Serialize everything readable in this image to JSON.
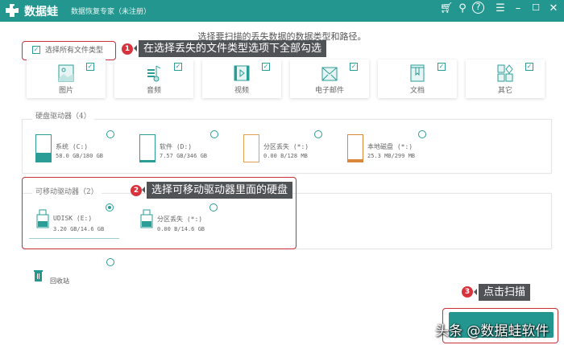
{
  "titlebar": {
    "app_name": "数据蛙",
    "subtitle": "数据恢复专家（未注册）",
    "icons": [
      "cart-icon",
      "pin-icon",
      "help-icon",
      "menu-icon",
      "minimize-icon",
      "maximize-icon",
      "close-icon"
    ]
  },
  "heading": "选择要扫描的丢失数据的数据类型和路径。",
  "select_all": {
    "label": "选择所有文件类型",
    "checked": true
  },
  "callouts": [
    {
      "num": "1",
      "text": "在选择丢失的文件类型选项下全部勾选"
    },
    {
      "num": "2",
      "text": "选择可移动驱动器里面的硬盘"
    },
    {
      "num": "3",
      "text": "点击扫描"
    }
  ],
  "file_types": [
    {
      "label": "图片",
      "icon": "image-icon",
      "checked": true
    },
    {
      "label": "音频",
      "icon": "audio-icon",
      "checked": true
    },
    {
      "label": "视频",
      "icon": "video-icon",
      "checked": true
    },
    {
      "label": "电子邮件",
      "icon": "email-icon",
      "checked": true
    },
    {
      "label": "文档",
      "icon": "document-icon",
      "checked": true
    },
    {
      "label": "其它",
      "icon": "other-icon",
      "checked": true
    }
  ],
  "hard_drives": {
    "title": "硬盘驱动器（4）",
    "items": [
      {
        "name": "系统 (C:)",
        "size": "58.0 GB/180 GB",
        "fill": 0.32,
        "color": "#2a9d96",
        "selected": false
      },
      {
        "name": "软件 (D:)",
        "size": "7.57 GB/346 GB",
        "fill": 0.02,
        "color": "#2a9d96",
        "selected": false
      },
      {
        "name": "分区丢失 (*:)",
        "size": "0.00  B/128 MB",
        "fill": 0,
        "color": "#e0a050",
        "selected": false
      },
      {
        "name": "本地磁盘 (*:)",
        "size": "25.3 MB/299 MB",
        "fill": 0.08,
        "color": "#d8883a",
        "selected": false
      }
    ]
  },
  "removable_drives": {
    "title": "可移动驱动器（2）",
    "items": [
      {
        "name": "UDISK (E:)",
        "size": "3.20 GB/14.6 GB",
        "selected": true
      },
      {
        "name": "分区丢失 (*:)",
        "size": "0.00  B/14.6 GB",
        "selected": false
      }
    ]
  },
  "recycle_bin": {
    "label": "回收站",
    "selected": false
  },
  "scan_button": {
    "label": ""
  },
  "watermark": "头条 @数据蛙软件",
  "colors": {
    "accent": "#23968f",
    "callout": "#d8323c"
  }
}
